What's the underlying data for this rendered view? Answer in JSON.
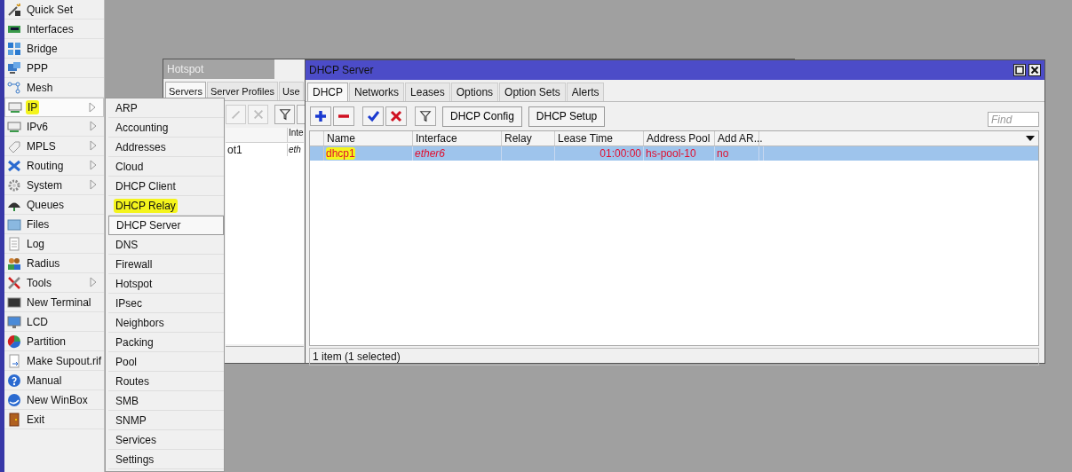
{
  "sidebar": {
    "items": [
      {
        "label": "Quick Set",
        "submenu": false,
        "selected": false,
        "highlighted": false
      },
      {
        "label": "Interfaces",
        "submenu": false,
        "selected": false,
        "highlighted": false
      },
      {
        "label": "Bridge",
        "submenu": false,
        "selected": false,
        "highlighted": false
      },
      {
        "label": "PPP",
        "submenu": false,
        "selected": false,
        "highlighted": false
      },
      {
        "label": "Mesh",
        "submenu": false,
        "selected": false,
        "highlighted": false
      },
      {
        "label": "IP",
        "submenu": true,
        "selected": true,
        "highlighted": true
      },
      {
        "label": "IPv6",
        "submenu": true,
        "selected": false,
        "highlighted": false
      },
      {
        "label": "MPLS",
        "submenu": true,
        "selected": false,
        "highlighted": false
      },
      {
        "label": "Routing",
        "submenu": true,
        "selected": false,
        "highlighted": false
      },
      {
        "label": "System",
        "submenu": true,
        "selected": false,
        "highlighted": false
      },
      {
        "label": "Queues",
        "submenu": false,
        "selected": false,
        "highlighted": false
      },
      {
        "label": "Files",
        "submenu": false,
        "selected": false,
        "highlighted": false
      },
      {
        "label": "Log",
        "submenu": false,
        "selected": false,
        "highlighted": false
      },
      {
        "label": "Radius",
        "submenu": false,
        "selected": false,
        "highlighted": false
      },
      {
        "label": "Tools",
        "submenu": true,
        "selected": false,
        "highlighted": false
      },
      {
        "label": "New Terminal",
        "submenu": false,
        "selected": false,
        "highlighted": false
      },
      {
        "label": "LCD",
        "submenu": false,
        "selected": false,
        "highlighted": false
      },
      {
        "label": "Partition",
        "submenu": false,
        "selected": false,
        "highlighted": false
      },
      {
        "label": "Make Supout.rif",
        "submenu": false,
        "selected": false,
        "highlighted": false
      },
      {
        "label": "Manual",
        "submenu": false,
        "selected": false,
        "highlighted": false
      },
      {
        "label": "New WinBox",
        "submenu": false,
        "selected": false,
        "highlighted": false
      },
      {
        "label": "Exit",
        "submenu": false,
        "selected": false,
        "highlighted": false
      }
    ]
  },
  "submenu": {
    "items": [
      {
        "label": "ARP",
        "selected": false,
        "highlighted": false
      },
      {
        "label": "Accounting",
        "selected": false,
        "highlighted": false
      },
      {
        "label": "Addresses",
        "selected": false,
        "highlighted": false
      },
      {
        "label": "Cloud",
        "selected": false,
        "highlighted": false
      },
      {
        "label": "DHCP Client",
        "selected": false,
        "highlighted": false
      },
      {
        "label": "DHCP Relay",
        "selected": false,
        "highlighted": true
      },
      {
        "label": "DHCP Server",
        "selected": true,
        "highlighted": false
      },
      {
        "label": "DNS",
        "selected": false,
        "highlighted": false
      },
      {
        "label": "Firewall",
        "selected": false,
        "highlighted": false
      },
      {
        "label": "Hotspot",
        "selected": false,
        "highlighted": false
      },
      {
        "label": "IPsec",
        "selected": false,
        "highlighted": false
      },
      {
        "label": "Neighbors",
        "selected": false,
        "highlighted": false
      },
      {
        "label": "Packing",
        "selected": false,
        "highlighted": false
      },
      {
        "label": "Pool",
        "selected": false,
        "highlighted": false
      },
      {
        "label": "Routes",
        "selected": false,
        "highlighted": false
      },
      {
        "label": "SMB",
        "selected": false,
        "highlighted": false
      },
      {
        "label": "SNMP",
        "selected": false,
        "highlighted": false
      },
      {
        "label": "Services",
        "selected": false,
        "highlighted": false
      },
      {
        "label": "Settings",
        "selected": false,
        "highlighted": false
      }
    ]
  },
  "hotspot_window": {
    "title": "Hotspot",
    "tabs": [
      {
        "label": "Servers",
        "selected": true
      },
      {
        "label": "Server Profiles",
        "selected": false
      },
      {
        "label": "Use",
        "selected": false
      }
    ],
    "column_2": "Inte",
    "row": {
      "column_1": "ot1",
      "column_2": "eth"
    }
  },
  "dhcp_window": {
    "title": "DHCP Server",
    "tabs": [
      {
        "label": "DHCP",
        "selected": true
      },
      {
        "label": "Networks",
        "selected": false
      },
      {
        "label": "Leases",
        "selected": false
      },
      {
        "label": "Options",
        "selected": false
      },
      {
        "label": "Option Sets",
        "selected": false
      },
      {
        "label": "Alerts",
        "selected": false
      }
    ],
    "buttons": [
      "DHCP Config",
      "DHCP Setup"
    ],
    "search": {
      "placeholder": "Find"
    },
    "columns": [
      "Name",
      "Interface",
      "Relay",
      "Lease Time",
      "Address Pool",
      "Add AR..."
    ],
    "rows": [
      {
        "selected": true,
        "invalid": true,
        "highlighted": true,
        "name": "dhcp1",
        "interface": "ether6",
        "lease_time": "01:00:00",
        "address_pool": "hs-pool-10",
        "add_arp": "no"
      }
    ],
    "status": "1 item (1 selected)"
  }
}
